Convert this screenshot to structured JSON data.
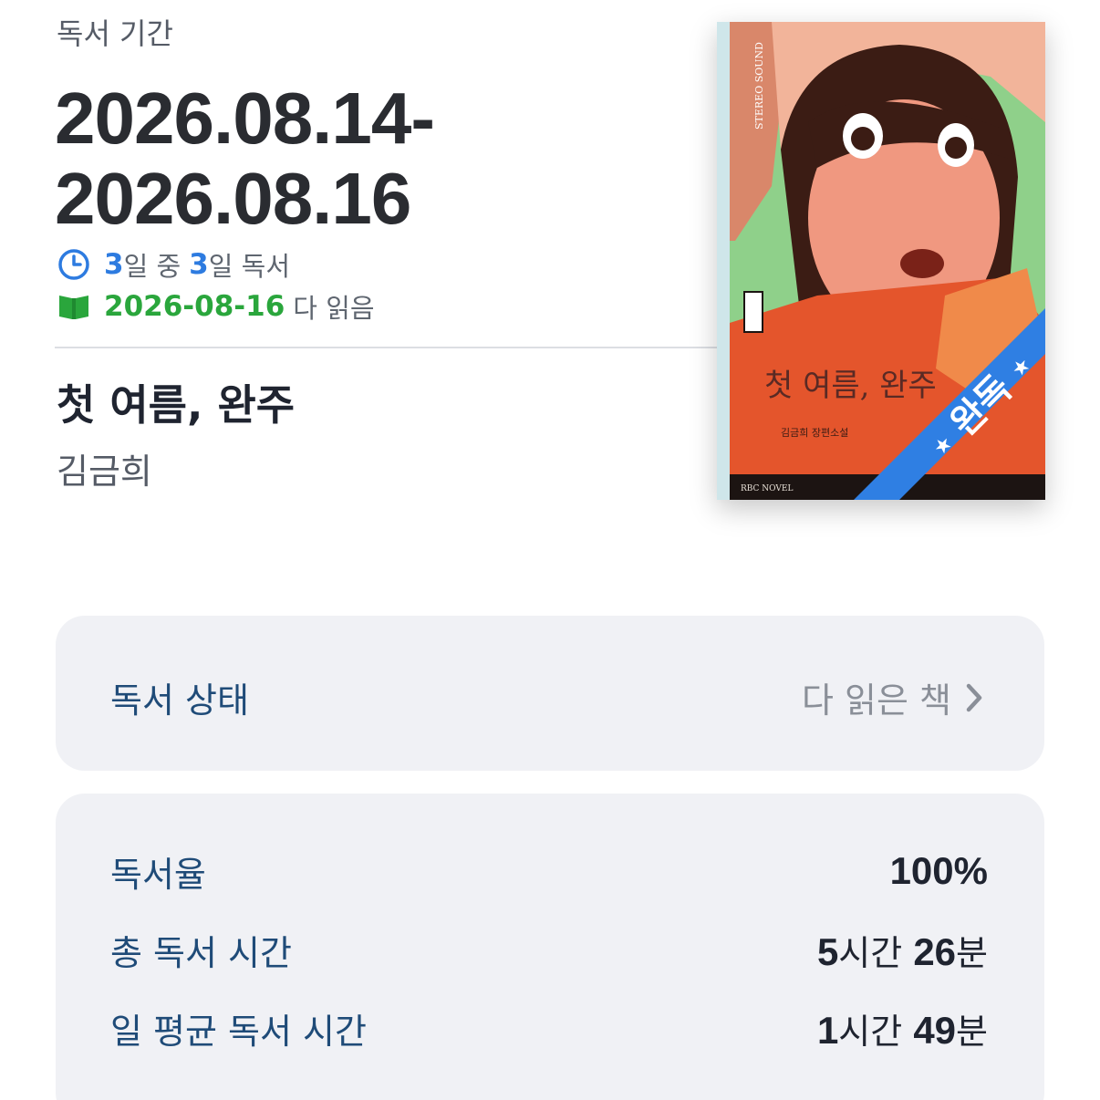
{
  "header": {
    "period_label": "독서 기간",
    "period_start": "2026.08.14-",
    "period_end": "2026.08.16",
    "days_read": "3",
    "days_mid": "일 중",
    "days_total": "3",
    "days_suffix": "일 독서",
    "finished_date": "2026-08-16",
    "finished_suffix": "다 읽음"
  },
  "book": {
    "title": "첫 여름, 완주",
    "author": "김금희",
    "cover_title": "첫 여름, 완주",
    "cover_publisher": "RBC NOVEL",
    "cover_subtitle": "김금희 장편소설",
    "cover_badge": "완독"
  },
  "status_card": {
    "label": "독서 상태",
    "value": "다 읽은 책"
  },
  "stats": [
    {
      "label": "독서율",
      "value_num": "100%",
      "value_unit": ""
    },
    {
      "label": "총 독서 시간",
      "value_h": "5",
      "value_h_unit": "시간",
      "value_m": "26",
      "value_m_unit": "분"
    },
    {
      "label": "일 평균 독서 시간",
      "value_h": "1",
      "value_h_unit": "시간",
      "value_m": "49",
      "value_m_unit": "분"
    }
  ],
  "colors": {
    "accent_blue": "#2d7be0",
    "accent_green": "#2aa63c",
    "badge_blue": "#2f7fe3",
    "card_bg": "#f0f1f5"
  },
  "icons": {
    "clock": "clock-icon",
    "book": "book-open-icon",
    "chevron": "chevron-right-icon"
  }
}
